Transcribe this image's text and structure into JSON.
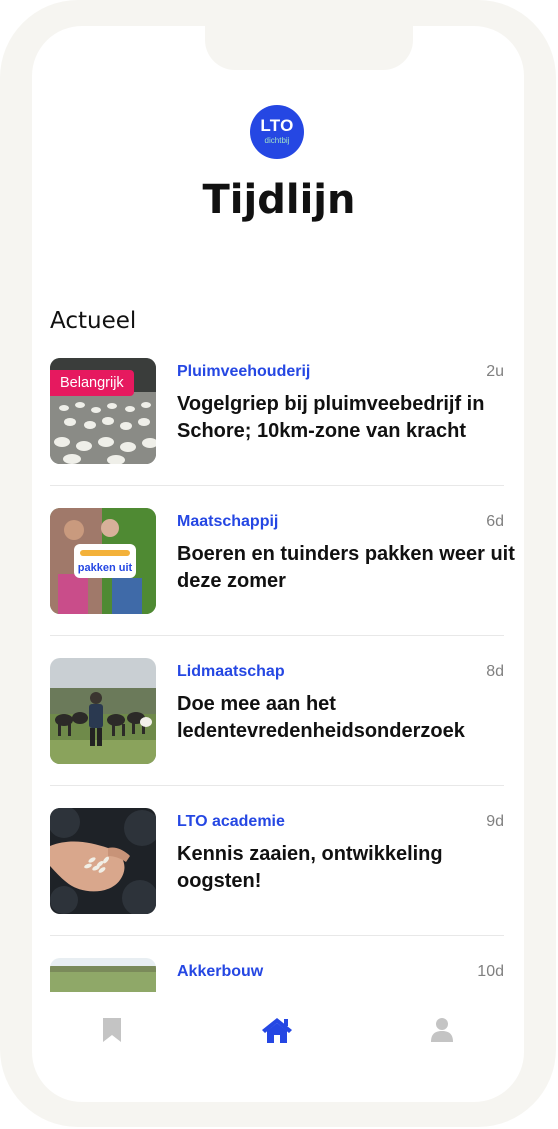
{
  "header": {
    "logo_text": "LTO",
    "logo_subtext": "dichtbij",
    "title": "Tijdlijn"
  },
  "section_title": "Actueel",
  "feed": [
    {
      "category": "Pluimveehouderij",
      "time": "2u",
      "headline": "Vogelgriep bij pluimveebedrijf in Schore; 10km-zone van kracht",
      "badge": "Belangrijk",
      "image": "poultry-barn"
    },
    {
      "category": "Maatschappij",
      "time": "6d",
      "headline": "Boeren en tuinders pakken weer uit deze zomer",
      "image": "event-poster",
      "image_text": "pakken uit"
    },
    {
      "category": "Lidmaatschap",
      "time": "8d",
      "headline": "Doe mee aan het ledentevredenheidsonderzoek",
      "image": "farmer-with-cows"
    },
    {
      "category": "LTO academie",
      "time": "9d",
      "headline": "Kennis zaaien, ontwikkeling oogsten!",
      "image": "hand-with-seeds"
    },
    {
      "category": "Akkerbouw",
      "time": "10d",
      "headline": "",
      "image": "field-landscape"
    }
  ],
  "tabbar": {
    "items": [
      {
        "name": "bookmarks",
        "icon": "bookmark-icon",
        "active": false
      },
      {
        "name": "home",
        "icon": "home-icon",
        "active": true
      },
      {
        "name": "profile",
        "icon": "user-icon",
        "active": false
      }
    ]
  },
  "colors": {
    "accent": "#2547e3",
    "badge": "#e6195f",
    "frame": "#f6f5f1",
    "muted_icon": "#c4c4c4"
  }
}
